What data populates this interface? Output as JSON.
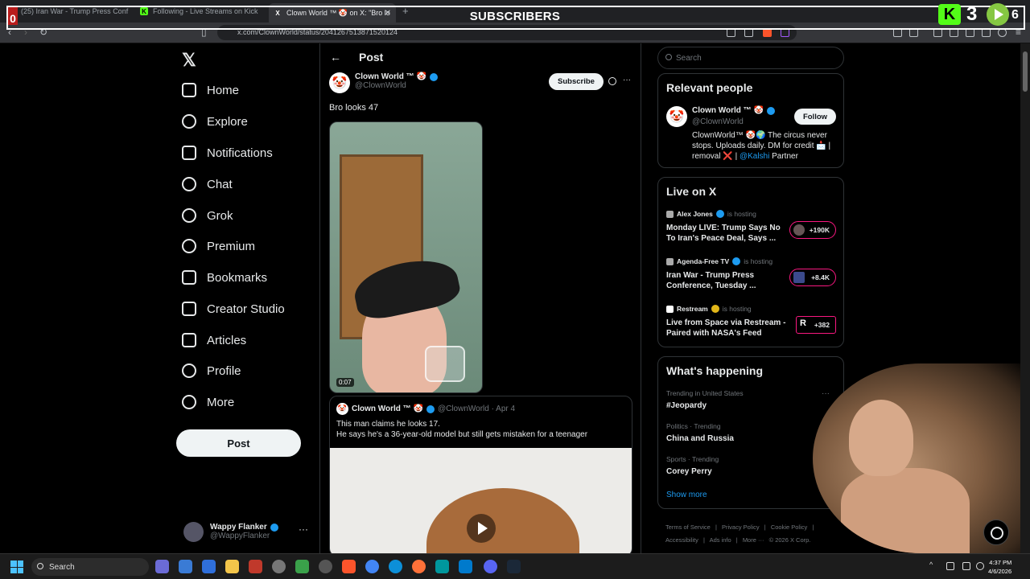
{
  "browser": {
    "tabs": [
      {
        "label": "(25) Iran War - Trump Press Conf",
        "favicon_color": "#ff0000"
      },
      {
        "label": "Following - Live Streams on Kick",
        "favicon_color": "#53fc18"
      },
      {
        "label": "Clown World ™ 🤡 on X: \"Bro lo",
        "favicon_color": "#000000"
      }
    ],
    "new_tab": "+",
    "url": "x.com/ClownWorld/status/2041267513871520124"
  },
  "overlay": {
    "title": "SUBSCRIBERS",
    "left_count": "0",
    "kick_count": "3",
    "rumble_count": "6"
  },
  "sidebar": {
    "items": [
      {
        "label": "Home",
        "icon": "home-icon"
      },
      {
        "label": "Explore",
        "icon": "search-icon"
      },
      {
        "label": "Notifications",
        "icon": "bell-icon"
      },
      {
        "label": "Chat",
        "icon": "chat-icon"
      },
      {
        "label": "Grok",
        "icon": "grok-icon"
      },
      {
        "label": "Premium",
        "icon": "verified-icon"
      },
      {
        "label": "Bookmarks",
        "icon": "bookmark-icon"
      },
      {
        "label": "Creator Studio",
        "icon": "rocket-icon"
      },
      {
        "label": "Articles",
        "icon": "article-icon"
      },
      {
        "label": "Profile",
        "icon": "profile-icon"
      },
      {
        "label": "More",
        "icon": "more-icon"
      }
    ],
    "post_button": "Post",
    "account": {
      "name": "Wappy Flanker",
      "handle": "@WappyFlanker"
    }
  },
  "post": {
    "header": "Post",
    "author_name": "Clown World ™ 🤡",
    "author_handle": "@ClownWorld",
    "subscribe": "Subscribe",
    "text": "Bro looks 47",
    "video_time": "0:07",
    "quote": {
      "author_name": "Clown World ™ 🤡",
      "author_handle": "@ClownWorld · Apr 4",
      "line1": "This man claims he looks 17.",
      "line2": "He says he's a 36-year-old model but still gets mistaken for a teenager"
    }
  },
  "right": {
    "search_placeholder": "Search",
    "relevant": {
      "title": "Relevant people",
      "name": "Clown World ™ 🤡",
      "handle": "@ClownWorld",
      "follow": "Follow",
      "bio_text": "ClownWorld™ 🤡🌍 The circus never stops. Uploads daily. DM for credit 📩 | removal ❌ | ",
      "bio_link": "@Kalshi",
      "bio_end": " Partner"
    },
    "live": {
      "title": "Live on X",
      "items": [
        {
          "host": "Alex Jones",
          "status": "is hosting",
          "title": "Monday LIVE: Trump Says No To Iran's Peace Deal, Says ...",
          "count": "+190K"
        },
        {
          "host": "Agenda-Free TV",
          "status": "is hosting",
          "title": "Iran War - Trump Press Conference, Tuesday ...",
          "count": "+8.4K"
        },
        {
          "host": "Restream",
          "status": "is hosting",
          "title": "Live from Space via Restream - Paired with NASA's Feed",
          "count": "+382",
          "badge_letter": "R"
        }
      ]
    },
    "happening": {
      "title": "What's happening",
      "trends": [
        {
          "meta": "Trending in United States",
          "name": "#Jeopardy"
        },
        {
          "meta": "Politics · Trending",
          "name": "China and Russia"
        },
        {
          "meta": "Sports · Trending",
          "name": "Corey Perry"
        }
      ],
      "more": "···",
      "show_more": "Show more"
    },
    "footer": [
      "Terms of Service",
      "|",
      "Privacy Policy",
      "|",
      "Cookie Policy",
      "|",
      "Accessibility",
      "|",
      "Ads info",
      "|",
      "More ···",
      "© 2026 X Corp."
    ]
  },
  "taskbar": {
    "search": "Search",
    "time": "4:37 PM",
    "date": "4/6/2026"
  }
}
